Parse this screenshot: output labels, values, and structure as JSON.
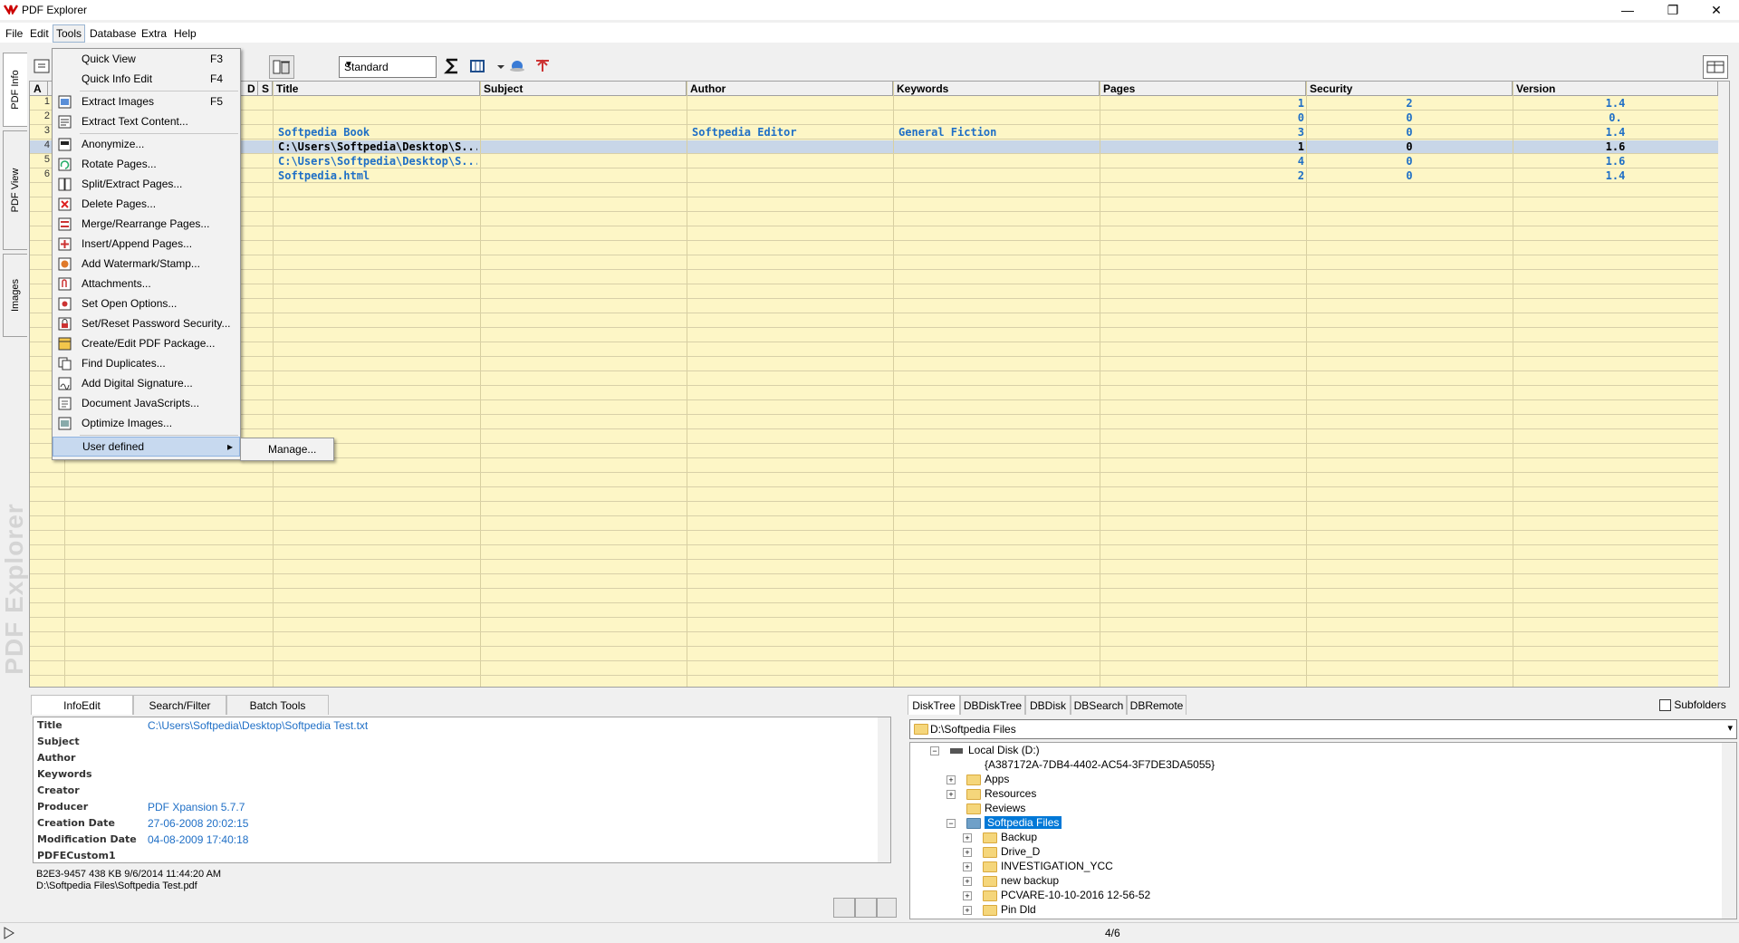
{
  "window": {
    "title": "PDF Explorer",
    "minimize": "—",
    "restore": "❐",
    "close": "✕"
  },
  "menubar": [
    "File",
    "Edit",
    "Tools",
    "Database",
    "Extra",
    "Help"
  ],
  "left_tabs": [
    "PDF Info",
    "PDF View",
    "Images"
  ],
  "brand_watermark": "PDF Explorer",
  "toolbar": {
    "combo_value": "Standard"
  },
  "grid": {
    "columns": [
      "A",
      "",
      "D",
      "S",
      "Title",
      "Subject",
      "Author",
      "Keywords",
      "Pages",
      "Security",
      "Version"
    ],
    "row_numbers": [
      "1",
      "2",
      "3",
      "4",
      "5",
      "6"
    ],
    "rows": [
      {
        "title": "",
        "subject": "",
        "author": "",
        "keywords": "",
        "pages": "1",
        "security": "2",
        "version": "1.4"
      },
      {
        "title": "",
        "subject": "",
        "author": "",
        "keywords": "",
        "pages": "0",
        "security": "0",
        "version": "0."
      },
      {
        "title": "Softpedia Book",
        "subject": "",
        "author": "Softpedia Editor",
        "keywords": "General Fiction",
        "pages": "3",
        "security": "0",
        "version": "1.4"
      },
      {
        "title": "C:\\Users\\Softpedia\\Desktop\\S...",
        "subject": "",
        "author": "",
        "keywords": "",
        "pages": "1",
        "security": "0",
        "version": "1.6"
      },
      {
        "title": "C:\\Users\\Softpedia\\Desktop\\S...",
        "subject": "",
        "author": "",
        "keywords": "",
        "pages": "4",
        "security": "0",
        "version": "1.6"
      },
      {
        "title": "Softpedia.html",
        "subject": "",
        "author": "",
        "keywords": "",
        "pages": "2",
        "security": "0",
        "version": "1.4"
      }
    ]
  },
  "tools_menu": {
    "quick_view": {
      "label": "Quick View",
      "shortcut": "F3"
    },
    "quick_info_edit": {
      "label": "Quick Info Edit",
      "shortcut": "F4"
    },
    "extract_images": {
      "label": "Extract Images",
      "shortcut": "F5"
    },
    "extract_text": {
      "label": "Extract Text Content..."
    },
    "anonymize": {
      "label": "Anonymize..."
    },
    "rotate": {
      "label": "Rotate Pages..."
    },
    "split": {
      "label": "Split/Extract Pages..."
    },
    "delete": {
      "label": "Delete Pages..."
    },
    "merge": {
      "label": "Merge/Rearrange Pages..."
    },
    "insert": {
      "label": "Insert/Append Pages..."
    },
    "watermark": {
      "label": "Add Watermark/Stamp..."
    },
    "attachments": {
      "label": "Attachments..."
    },
    "open_options": {
      "label": "Set Open Options..."
    },
    "password": {
      "label": "Set/Reset Password Security..."
    },
    "package": {
      "label": "Create/Edit PDF Package..."
    },
    "duplicates": {
      "label": "Find Duplicates..."
    },
    "signature": {
      "label": "Add Digital Signature..."
    },
    "javascripts": {
      "label": "Document JavaScripts..."
    },
    "optimize": {
      "label": "Optimize Images..."
    },
    "user_defined": {
      "label": "User defined"
    },
    "submenu_manage": "Manage..."
  },
  "info_panel": {
    "tabs": [
      "InfoEdit",
      "Search/Filter",
      "Batch Tools"
    ],
    "fields": [
      {
        "key": "Title",
        "value": "C:\\Users\\Softpedia\\Desktop\\Softpedia Test.txt"
      },
      {
        "key": "Subject",
        "value": ""
      },
      {
        "key": "Author",
        "value": ""
      },
      {
        "key": "Keywords",
        "value": ""
      },
      {
        "key": "Creator",
        "value": ""
      },
      {
        "key": "Producer",
        "value": "PDF Xpansion 5.7.7"
      },
      {
        "key": "Creation Date",
        "value": "27-06-2008 20:02:15"
      },
      {
        "key": "Modification Date",
        "value": "04-08-2009 17:40:18"
      },
      {
        "key": "PDFECustom1",
        "value": ""
      }
    ],
    "status_line1": "B2E3-9457     438 KB  9/6/2014 11:44:20 AM",
    "status_line2": "D:\\Softpedia Files\\Softpedia Test.pdf"
  },
  "tree_panel": {
    "tabs": [
      "DiskTree",
      "DBDiskTree",
      "DBDisk",
      "DBSearch",
      "DBRemote"
    ],
    "subfolders_label": "Subfolders",
    "path": "D:\\Softpedia Files",
    "nodes": [
      {
        "label": "Local Disk (D:)"
      },
      {
        "label": "{A387172A-7DB4-4402-AC54-3F7DE3DA5055}"
      },
      {
        "label": "Apps"
      },
      {
        "label": "Resources"
      },
      {
        "label": "Reviews"
      },
      {
        "label": "Softpedia Files"
      },
      {
        "label": "Backup"
      },
      {
        "label": "Drive_D"
      },
      {
        "label": "INVESTIGATION_YCC"
      },
      {
        "label": "new backup"
      },
      {
        "label": "PCVARE-10-10-2016 12-56-52"
      },
      {
        "label": "Pin Dld"
      }
    ]
  },
  "statusbar": {
    "position": "4/6"
  }
}
